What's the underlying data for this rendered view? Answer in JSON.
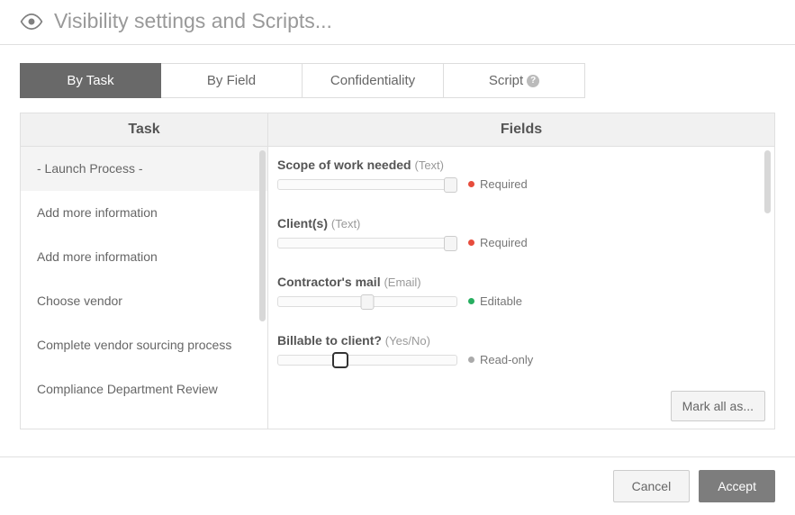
{
  "header": {
    "title": "Visibility settings and Scripts..."
  },
  "tabs": [
    {
      "label": "By Task",
      "active": true
    },
    {
      "label": "By Field",
      "active": false
    },
    {
      "label": "Confidentiality",
      "active": false
    },
    {
      "label": "Script",
      "active": false,
      "help": true
    }
  ],
  "columns": {
    "task": "Task",
    "fields": "Fields"
  },
  "tasks": [
    {
      "label": "- Launch Process -",
      "active": true
    },
    {
      "label": "Add more information",
      "active": false
    },
    {
      "label": "Add more information",
      "active": false
    },
    {
      "label": "Choose vendor",
      "active": false
    },
    {
      "label": "Complete vendor sourcing process",
      "active": false
    },
    {
      "label": "Compliance Department Review",
      "active": false
    }
  ],
  "fields": [
    {
      "name": "Scope of work needed",
      "type": "(Text)",
      "status": "Required",
      "dot": "red",
      "slider": "right"
    },
    {
      "name": "Client(s)",
      "type": "(Text)",
      "status": "Required",
      "dot": "red",
      "slider": "right"
    },
    {
      "name": "Contractor's mail",
      "type": "(Email)",
      "status": "Editable",
      "dot": "green",
      "slider": "mid"
    },
    {
      "name": "Billable to client?",
      "type": "(Yes/No)",
      "status": "Read-only",
      "dot": "gray",
      "slider": "left-thick"
    }
  ],
  "buttons": {
    "markAll": "Mark all as...",
    "cancel": "Cancel",
    "accept": "Accept"
  }
}
